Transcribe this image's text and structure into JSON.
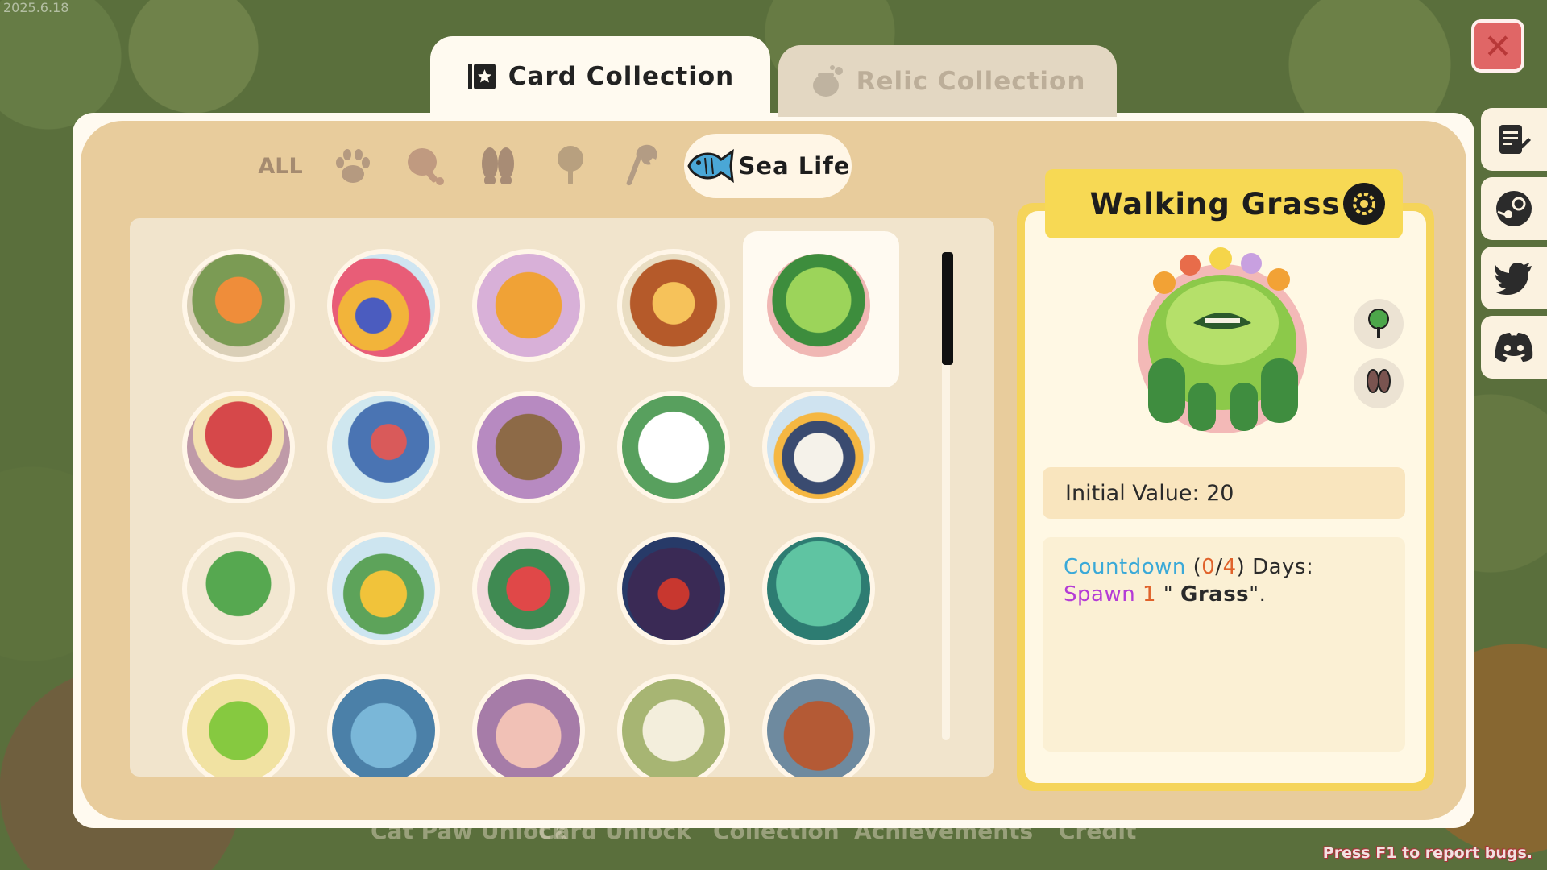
{
  "background": {
    "version": "2025.6.18"
  },
  "bottom_menu": [
    "Cat Paw Unlock",
    "Card Unlock",
    "Collection",
    "Achievements",
    "Credit"
  ],
  "bug_hint": "Press F1 to report bugs.",
  "tabs": [
    {
      "label": "Card Collection",
      "icon": "card-star-icon",
      "selected": true
    },
    {
      "label": "Relic Collection",
      "icon": "pot-icon",
      "selected": false
    }
  ],
  "filters": {
    "all_label": "ALL",
    "categories": [
      {
        "name": "paw-icon"
      },
      {
        "name": "drumstick-icon"
      },
      {
        "name": "footprints-icon"
      },
      {
        "name": "sprout-icon"
      },
      {
        "name": "wrench-icon"
      }
    ],
    "selected": {
      "label": "Sea Life",
      "icon": "fish-icon"
    }
  },
  "cards": [
    {
      "name": "gardener-card-icon"
    },
    {
      "name": "coral-reef-card-icon"
    },
    {
      "name": "tiger-card-icon"
    },
    {
      "name": "lion-card-icon"
    },
    {
      "name": "walking-grass-card-icon"
    },
    {
      "name": "mushroom-card-icon"
    },
    {
      "name": "detective-card-icon"
    },
    {
      "name": "hyena-card-icon"
    },
    {
      "name": "white-cat-card-icon"
    },
    {
      "name": "reader-bird-card-icon"
    },
    {
      "name": "tree-card-icon"
    },
    {
      "name": "owl-flower-card-icon"
    },
    {
      "name": "rose-card-icon"
    },
    {
      "name": "vampire-card-icon"
    },
    {
      "name": "sea-monster-card-icon"
    },
    {
      "name": "bean-card-icon"
    },
    {
      "name": "blue-rabbit-card-icon"
    },
    {
      "name": "pink-rabbit-card-icon"
    },
    {
      "name": "duck-card-icon"
    },
    {
      "name": "hen-card-icon"
    }
  ],
  "detail": {
    "title": "Walking Grass",
    "initial_value": "Initial Value: 20",
    "description": {
      "keyword_countdown": "Countdown",
      "paren_open": " (",
      "current": "0",
      "slash": "/",
      "total": "4",
      "paren_close": ") Days:",
      "spawn_word": "Spawn",
      "spawn_count": "1",
      "quote_open": " \" ",
      "spawn_item": "Grass",
      "quote_close": "\"."
    },
    "tags": [
      "sprout-icon",
      "footprints-icon"
    ]
  },
  "side_buttons": [
    "notes-icon",
    "steam-icon",
    "twitter-icon",
    "discord-icon"
  ],
  "colors": {
    "countdown": "#3aa9d8",
    "number": "#e0622a",
    "spawn": "#b43bd6",
    "panel": "#e8cc9c",
    "detail_border": "#f5d45a"
  }
}
